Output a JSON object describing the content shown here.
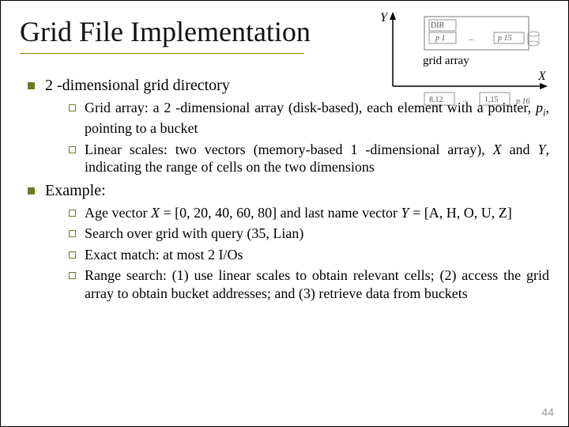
{
  "title": "Grid File Implementation",
  "diagram": {
    "y_label": "Y",
    "x_label": "X",
    "grid_label": "grid array",
    "dir_label": "DIR",
    "p1": "p 1",
    "p15": "p 15",
    "p16": "p 16",
    "col_a": "8,12",
    "col_b": "1,15",
    "dots": "..."
  },
  "sections": [
    {
      "heading": "2 -dimensional grid directory",
      "items": [
        "Grid array: a 2 -dimensional array (disk-based), each element with a pointer, <span class=\"it\">p<sub>i</sub></span>, pointing to a bucket",
        "Linear scales: two vectors (memory-based 1 -dimensional array), <span class=\"it\">X</span> and <span class=\"it\">Y</span>, indicating the range of cells on the two dimensions"
      ]
    },
    {
      "heading": "Example:",
      "items": [
        "Age vector <span class=\"it\">X</span> = [0, 20, 40, 60, 80] and last name vector <span class=\"it\">Y</span> = [A, H, O, U, Z]",
        "Search over grid with query (35, Lian)",
        "Exact match: at most 2 I/Os",
        "Range search: (1) use linear scales to obtain relevant cells; (2) access the grid array to obtain bucket addresses; and (3) retrieve data from buckets"
      ]
    }
  ],
  "page_number": "44"
}
